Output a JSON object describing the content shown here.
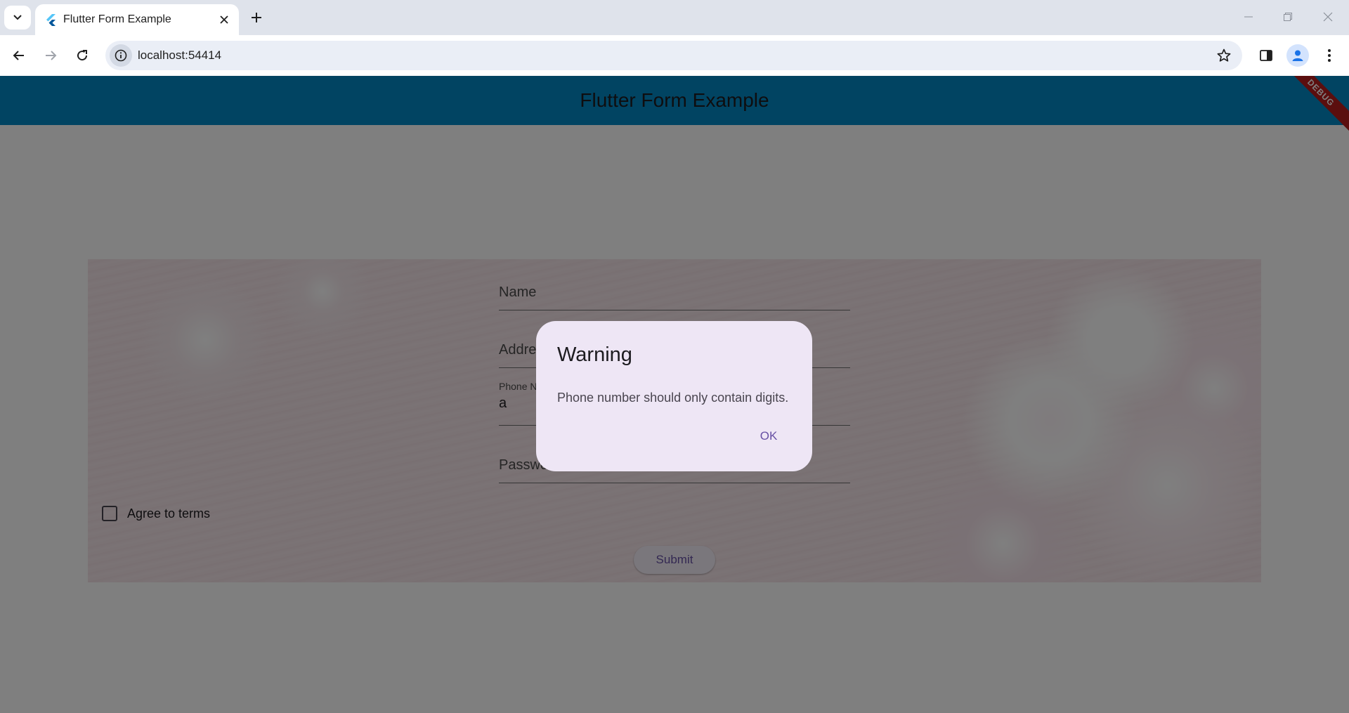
{
  "browser": {
    "tab_title": "Flutter Form Example",
    "url": "localhost:54414",
    "accent": "#1a73e8"
  },
  "app": {
    "title": "Flutter Form Example",
    "debug_banner": "DEBUG",
    "appbar_color": "#0388c4",
    "form": {
      "name_label": "Name",
      "address_label": "Address",
      "phone_label": "Phone Number",
      "phone_value": "a",
      "password_label": "Password",
      "agree_label": "Agree to terms",
      "agree_checked": false,
      "submit_label": "Submit"
    },
    "dialog": {
      "title": "Warning",
      "content": "Phone number should only contain digits.",
      "ok_label": "OK"
    }
  }
}
